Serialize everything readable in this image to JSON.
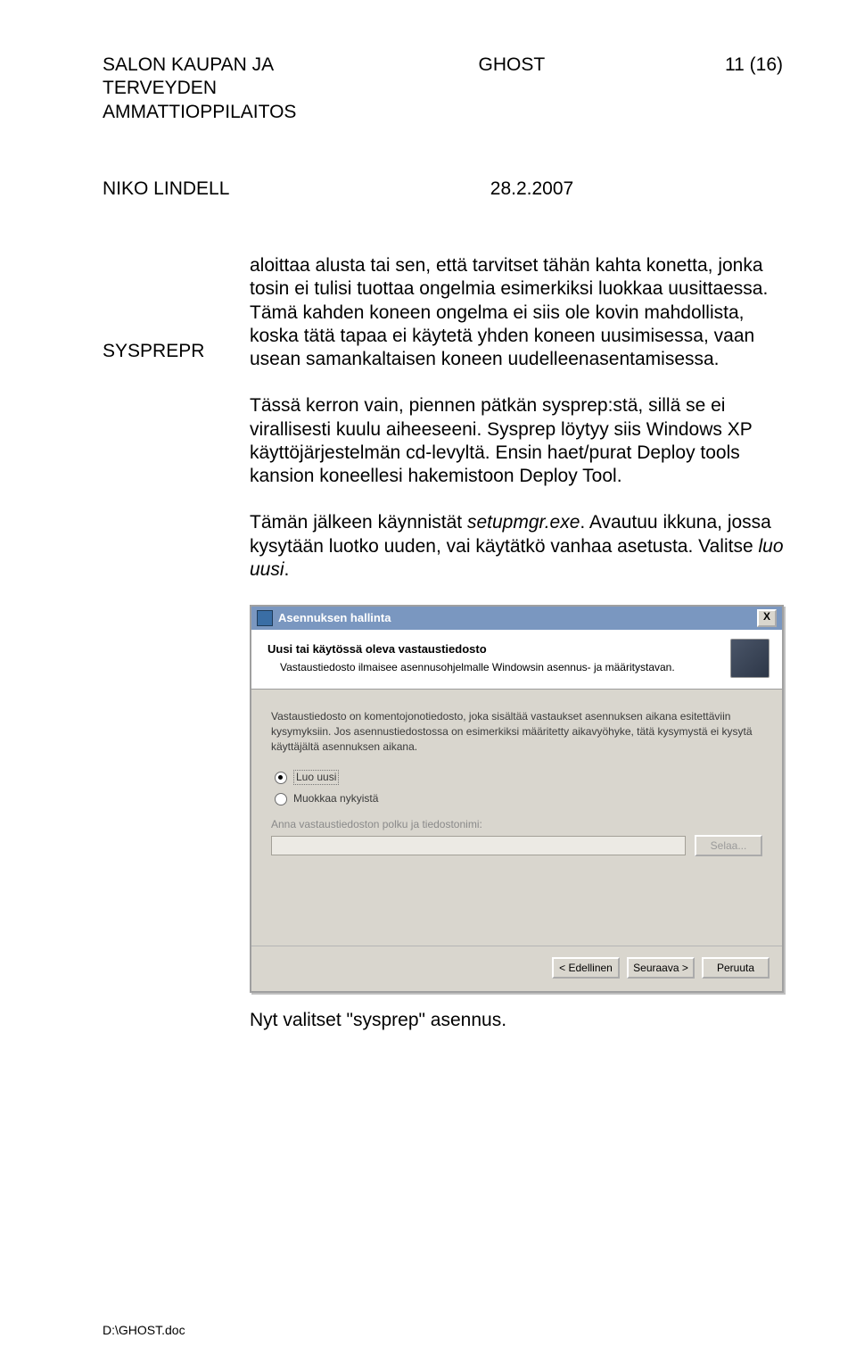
{
  "header": {
    "left1": "SALON KAUPAN JA TERVEYDEN",
    "left2": "AMMATTIOPPILAITOS",
    "center": "GHOST",
    "right": "11 (16)",
    "line2_left": "NIKO LINDELL",
    "line2_center": "28.2.2007"
  },
  "side_label": "SYSPREPR",
  "paragraphs": {
    "p1": "aloittaa alusta tai sen, että tarvitset tähän kahta konetta, jonka tosin ei tulisi tuottaa ongelmia esimerkiksi luokkaa uusittaessa. Tämä kahden koneen ongelma ei siis ole kovin mahdollista, koska tätä tapaa ei käytetä yhden koneen uusimisessa, vaan usean samankaltaisen koneen uudelleenasentamisessa.",
    "p2": "Tässä kerron vain, piennen pätkän sysprep:stä, sillä se ei virallisesti kuulu aiheeseeni. Sysprep löytyy siis Windows XP käyttöjärjestelmän cd-levyltä. Ensin haet/purat Deploy tools kansion koneellesi hakemistoon Deploy Tool.",
    "p3a": "Tämän jälkeen käynnistät ",
    "p3_em": "setupmgr.exe",
    "p3b": ". Avautuu ikkuna, jossa kysytään luotko uuden, vai käytätkö vanhaa asetusta. Valitse ",
    "p3_em2": "luo uusi",
    "p3c": "."
  },
  "dialog": {
    "title": "Asennuksen hallinta",
    "banner_title": "Uusi tai käytössä oleva vastaustiedosto",
    "banner_sub": "Vastaustiedosto ilmaisee asennusohjelmalle Windowsin asennus- ja määritystavan.",
    "intro": "Vastaustiedosto on komentojonotiedosto, joka sisältää vastaukset asennuksen aikana esitettäviin kysymyksiin. Jos asennustiedostossa on esimerkiksi määritetty aikavyöhyke, tätä kysymystä ei kysytä käyttäjältä asennuksen aikana.",
    "opt_create": "Luo uusi",
    "opt_edit": "Muokkaa nykyistä",
    "path_label": "Anna vastaustiedoston polku ja tiedostonimi:",
    "browse": "Selaa...",
    "prev": "< Edellinen",
    "next": "Seuraava >",
    "cancel": "Peruuta",
    "close": "X"
  },
  "post_dialog": "Nyt valitset \"sysprep\" asennus.",
  "footer_path": "D:\\GHOST.doc"
}
